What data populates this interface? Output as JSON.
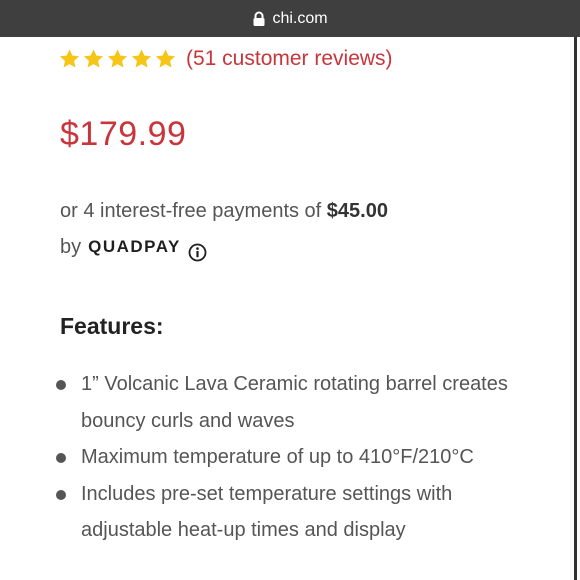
{
  "browser": {
    "url": "chi.com",
    "lock_icon": "lock-icon"
  },
  "product": {
    "rating": {
      "stars": 5,
      "max_stars": 5,
      "star_color": "#f5c518",
      "reviews_text": "(51 customer reviews)"
    },
    "price": "$179.99",
    "price_color": "#c8353a",
    "installments": {
      "text": "or 4 interest-free payments of",
      "amount": "$45.00",
      "by": "by",
      "provider": "QUADPAY",
      "info_icon": "info-icon"
    },
    "features_title": "Features:",
    "features": [
      "1” Volcanic Lava Ceramic rotating barrel creates bouncy curls and waves",
      "Maximum temperature of up to 410°F/210°C",
      "Includes pre-set temperature settings with adjustable heat-up times and display"
    ]
  }
}
